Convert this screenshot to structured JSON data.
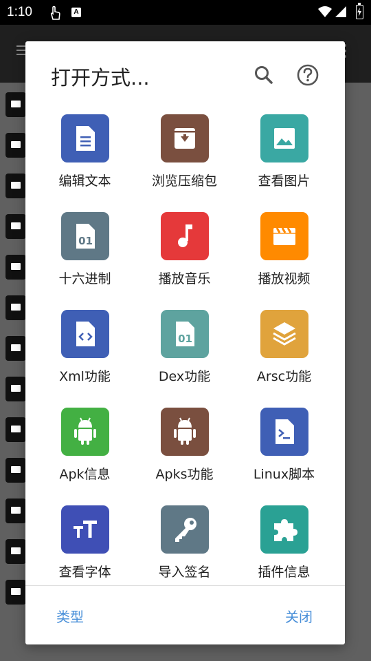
{
  "status_bar": {
    "time": "1:10",
    "touch_icon": "touch-icon",
    "a_icon": "A",
    "wifi_icon": "wifi-icon",
    "signal_icon": "signal-icon",
    "battery_icon": "battery-charging-icon"
  },
  "dialog": {
    "title": "打开方式...",
    "search_icon": "search-icon",
    "help_icon": "help-icon",
    "items": [
      {
        "label": "编辑文本",
        "icon": "document-icon",
        "color": "#3f5fb5"
      },
      {
        "label": "浏览压缩包",
        "icon": "archive-icon",
        "color": "#7a4f3f"
      },
      {
        "label": "查看图片",
        "icon": "image-icon",
        "color": "#3aa8a3"
      },
      {
        "label": "十六进制",
        "icon": "binary-file-icon",
        "color": "#5f7886"
      },
      {
        "label": "播放音乐",
        "icon": "music-note-icon",
        "color": "#e5393a"
      },
      {
        "label": "播放视频",
        "icon": "clapperboard-icon",
        "color": "#ff8a00"
      },
      {
        "label": "Xml功能",
        "icon": "code-file-icon",
        "color": "#3f5fb5"
      },
      {
        "label": "Dex功能",
        "icon": "binary-file-icon",
        "color": "#5ea39f"
      },
      {
        "label": "Arsc功能",
        "icon": "layers-icon",
        "color": "#e0a33c"
      },
      {
        "label": "Apk信息",
        "icon": "android-icon",
        "color": "#43b043"
      },
      {
        "label": "Apks功能",
        "icon": "android-icon",
        "color": "#7a4f3f"
      },
      {
        "label": "Linux脚本",
        "icon": "terminal-file-icon",
        "color": "#3f5fb5"
      },
      {
        "label": "查看字体",
        "icon": "font-icon",
        "color": "#3f4fb5"
      },
      {
        "label": "导入签名",
        "icon": "key-icon",
        "color": "#5f7886"
      },
      {
        "label": "插件信息",
        "icon": "puzzle-icon",
        "color": "#2aa194"
      }
    ],
    "type_button": "类型",
    "close_button": "关闭"
  }
}
